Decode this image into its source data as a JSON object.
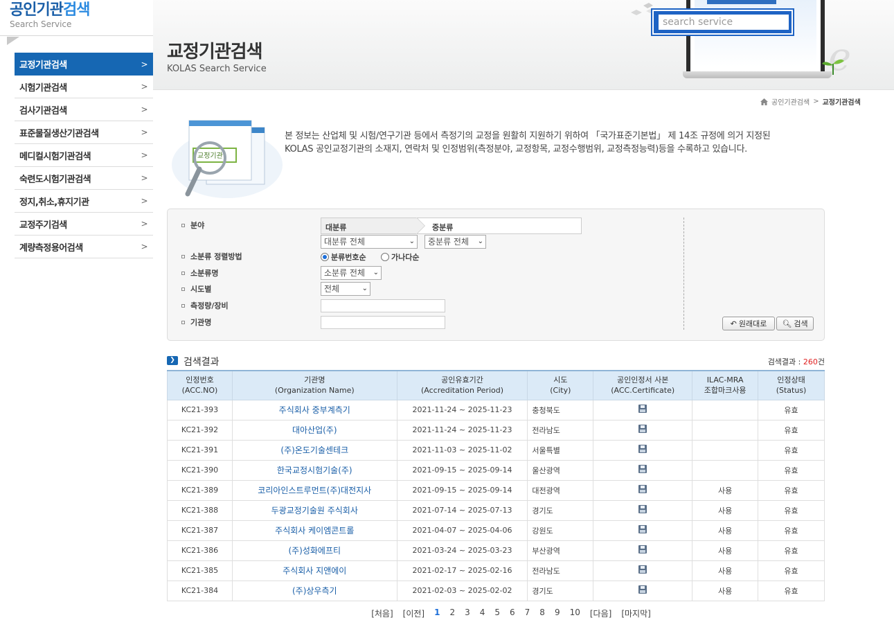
{
  "logo": {
    "title_main": "공인기관",
    "title_accent": "검색",
    "subtitle": "Search Service"
  },
  "sidebar": {
    "items": [
      {
        "label": "교정기관검색",
        "active": true
      },
      {
        "label": "시험기관검색",
        "active": false
      },
      {
        "label": "검사기관검색",
        "active": false
      },
      {
        "label": "표준물질생산기관검색",
        "active": false
      },
      {
        "label": "메디컬시험기관검색",
        "active": false
      },
      {
        "label": "숙련도시험기관검색",
        "active": false
      },
      {
        "label": "정지,취소,휴지기관",
        "active": false
      },
      {
        "label": "교정주기검색",
        "active": false
      },
      {
        "label": "계량측정용어검색",
        "active": false
      }
    ]
  },
  "banner": {
    "title": "교정기관검색",
    "subtitle": "KOLAS Search Service",
    "search_placeholder": "search service"
  },
  "breadcrumb": {
    "home": "공인기관검색",
    "sep": ">",
    "current": "교정기관검색"
  },
  "intro": {
    "illustration_label": "교정기관",
    "line1": "본 정보는 산업체 및 시험/연구기관 등에서 측정기의 교정을 원활히 지원하기 위하여 「국가표준기본법」 제 14조 규정에 의거 지정된",
    "line2": "KOLAS 공인교정기관의 소재지, 연락처 및 인정범위(측정분야, 교정항목, 교정수행범위, 교정측정능력)등을 수록하고 있습니다."
  },
  "form": {
    "field_label": "분야",
    "major_header": "대분류",
    "middle_header": "중분류",
    "major_value": "대분류 전체",
    "middle_value": "중분류 전체",
    "sort_label": "소분류 정렬방법",
    "sort_opt1": "분류번호순",
    "sort_opt2": "가나다순",
    "minor_label": "소분류명",
    "minor_value": "소분류 전체",
    "region_label": "시도별",
    "region_value": "전체",
    "measure_label": "측정량/장비",
    "org_label": "기관명",
    "reset_label": "원래대로",
    "search_label": "검색"
  },
  "results": {
    "title": "검색결과",
    "count_prefix": "검색결과 : ",
    "count": "260",
    "count_suffix": "건",
    "columns": [
      {
        "ko": "인정번호",
        "en": "(ACC.NO)"
      },
      {
        "ko": "기관명",
        "en": "(Organization Name)"
      },
      {
        "ko": "공인유효기간",
        "en": "(Accreditation Period)"
      },
      {
        "ko": "시도",
        "en": "(City)"
      },
      {
        "ko": "공인인정서 사본",
        "en": "(ACC.Certificate)"
      },
      {
        "ko": "ILAC-MRA",
        "en": "조합마크사용"
      },
      {
        "ko": "인정상태",
        "en": "(Status)"
      }
    ],
    "rows": [
      {
        "no": "KC21-393",
        "org": "주식회사 중부계측기",
        "period": "2021-11-24 ~ 2025-11-23",
        "city": "충청북도",
        "mra": "",
        "status": "유효"
      },
      {
        "no": "KC21-392",
        "org": "대아산업(주)",
        "period": "2021-11-24 ~ 2025-11-23",
        "city": "전라남도",
        "mra": "",
        "status": "유효"
      },
      {
        "no": "KC21-391",
        "org": "(주)온도기술센테크",
        "period": "2021-11-03 ~ 2025-11-02",
        "city": "서울특별",
        "mra": "",
        "status": "유효"
      },
      {
        "no": "KC21-390",
        "org": "한국교정시험기술(주)",
        "period": "2021-09-15 ~ 2025-09-14",
        "city": "울산광역",
        "mra": "",
        "status": "유효"
      },
      {
        "no": "KC21-389",
        "org": "코리아인스트루먼트(주)대전지사",
        "period": "2021-09-15 ~ 2025-09-14",
        "city": "대전광역",
        "mra": "사용",
        "status": "유효"
      },
      {
        "no": "KC21-388",
        "org": "두광교정기술원 주식회사",
        "period": "2021-07-14 ~ 2025-07-13",
        "city": "경기도",
        "mra": "사용",
        "status": "유효"
      },
      {
        "no": "KC21-387",
        "org": "주식회사 케이엠콘트롤",
        "period": "2021-04-07 ~ 2025-04-06",
        "city": "강원도",
        "mra": "사용",
        "status": "유효"
      },
      {
        "no": "KC21-386",
        "org": "(주)성화에프티",
        "period": "2021-03-24 ~ 2025-03-23",
        "city": "부산광역",
        "mra": "사용",
        "status": "유효"
      },
      {
        "no": "KC21-385",
        "org": "주식회사 지앤에이",
        "period": "2021-02-17 ~ 2025-02-16",
        "city": "전라남도",
        "mra": "사용",
        "status": "유효"
      },
      {
        "no": "KC21-384",
        "org": "(주)상우측기",
        "period": "2021-02-03 ~ 2025-02-02",
        "city": "경기도",
        "mra": "사용",
        "status": "유효"
      }
    ]
  },
  "pager": {
    "first": "[처음]",
    "prev": "[이전]",
    "pages": [
      "1",
      "2",
      "3",
      "4",
      "5",
      "6",
      "7",
      "8",
      "9",
      "10"
    ],
    "current": "1",
    "next": "[다음]",
    "last": "[마지막]"
  }
}
